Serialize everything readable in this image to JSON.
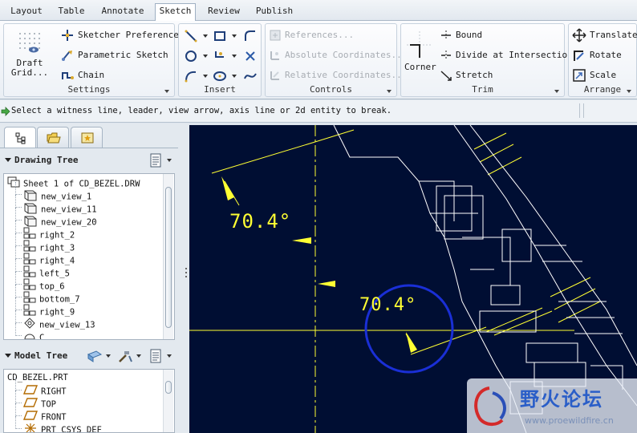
{
  "tabs": [
    {
      "label": "Layout",
      "active": false
    },
    {
      "label": "Table",
      "active": false
    },
    {
      "label": "Annotate",
      "active": false
    },
    {
      "label": "Sketch",
      "active": true
    },
    {
      "label": "Review",
      "active": false
    },
    {
      "label": "Publish",
      "active": false
    }
  ],
  "ribbon": {
    "settings": {
      "label": "Settings",
      "draft_grid": "Draft\nGrid...",
      "sketcher_preferences": "Sketcher Preferences",
      "parametric_sketch": "Parametric Sketch",
      "chain": "Chain"
    },
    "insert": {
      "label": "Insert"
    },
    "controls": {
      "label": "Controls",
      "references": "References...",
      "absolute_coordinates": "Absolute Coordinates...",
      "relative_coordinates": "Relative Coordinates..."
    },
    "trim": {
      "label": "Trim",
      "corner": "Corner",
      "bound": "Bound",
      "divide": "Divide at Intersection",
      "stretch": "Stretch"
    },
    "arrange": {
      "label": "Arrange",
      "translate": "Translate",
      "rotate": "Rotate",
      "scale": "Scale"
    }
  },
  "message": "Select a witness line, leader, view arrow, axis line or 2d entity to break.",
  "drawing_tree": {
    "title": "Drawing Tree",
    "items": [
      {
        "label": "Sheet 1 of CD_BEZEL.DRW",
        "icon": "sheet-icon"
      },
      {
        "label": "new_view_1",
        "icon": "general-view-icon"
      },
      {
        "label": "new_view_11",
        "icon": "general-view-icon"
      },
      {
        "label": "new_view_20",
        "icon": "general-view-icon"
      },
      {
        "label": "right_2",
        "icon": "projection-view-icon"
      },
      {
        "label": "right_3",
        "icon": "projection-view-icon"
      },
      {
        "label": "right_4",
        "icon": "projection-view-icon"
      },
      {
        "label": "left_5",
        "icon": "projection-view-icon"
      },
      {
        "label": "top_6",
        "icon": "projection-view-icon"
      },
      {
        "label": "bottom_7",
        "icon": "projection-view-icon"
      },
      {
        "label": "right_9",
        "icon": "projection-view-icon"
      },
      {
        "label": "new_view_13",
        "icon": "detail-view-icon"
      },
      {
        "label": "C",
        "icon": "section-view-icon"
      }
    ]
  },
  "model_tree": {
    "title": "Model Tree",
    "items": [
      {
        "label": "CD_BEZEL.PRT",
        "icon": ""
      },
      {
        "label": "RIGHT",
        "icon": "datum-plane-icon"
      },
      {
        "label": "TOP",
        "icon": "datum-plane-icon"
      },
      {
        "label": "FRONT",
        "icon": "datum-plane-icon"
      },
      {
        "label": "PRT_CSYS_DEF",
        "icon": "csys-icon"
      }
    ]
  },
  "drawing": {
    "dimension_1": "70.4°",
    "dimension_2": "70.4°"
  },
  "watermark": {
    "text": "野火论坛",
    "url_text": "www.proewildfire.cn"
  },
  "colors": {
    "canvas_bg": "#000e33",
    "geometry": "#ffffff",
    "dimension": "#ffff33",
    "selection_circle": "#1a2fd6"
  }
}
